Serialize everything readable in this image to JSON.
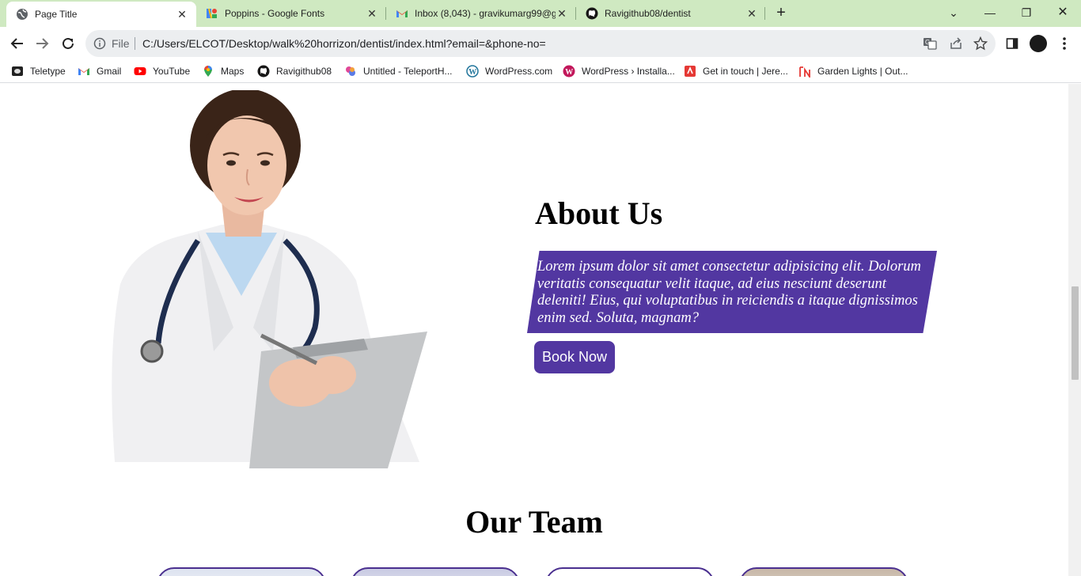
{
  "browser": {
    "tabs": [
      {
        "title": "Page Title",
        "active": true,
        "icon": "globe-icon"
      },
      {
        "title": "Poppins - Google Fonts",
        "active": false,
        "icon": "google-fonts-icon"
      },
      {
        "title": "Inbox (8,043) - gravikumarg99@g",
        "active": false,
        "icon": "gmail-icon"
      },
      {
        "title": "Ravigithub08/dentist",
        "active": false,
        "icon": "github-icon"
      }
    ],
    "close_glyph": "✕",
    "newtab_glyph": "+",
    "window": {
      "minimize": "—",
      "restore": "❐",
      "close": "✕",
      "dropdown": "⌄"
    },
    "omnibox": {
      "scheme_label": "File",
      "url": "C:/Users/ELCOT/Desktop/walk%20horrizon/dentist/index.html?email=&phone-no="
    },
    "bookmarks": [
      {
        "label": "Teletype",
        "icon": "teletype-icon",
        "color": "#222222"
      },
      {
        "label": "Gmail",
        "icon": "gmail-icon",
        "color": "#EA4335"
      },
      {
        "label": "YouTube",
        "icon": "youtube-icon",
        "color": "#FF0000"
      },
      {
        "label": "Maps",
        "icon": "maps-icon",
        "color": "#34A853"
      },
      {
        "label": "Ravigithub08",
        "icon": "github-icon",
        "color": "#181717"
      },
      {
        "label": "Untitled - TeleportH...",
        "icon": "teleporthq-icon",
        "color": "#E04898"
      },
      {
        "label": "WordPress.com",
        "icon": "wordpress-icon",
        "color": "#21759B"
      },
      {
        "label": "WordPress › Installa...",
        "icon": "wordpress-install-icon",
        "color": "#C2185B"
      },
      {
        "label": "Get in touch | Jere...",
        "icon": "jeremy-icon",
        "color": "#E53935"
      },
      {
        "label": "Garden Lights | Out...",
        "icon": "garden-lights-icon",
        "color": "#E53935"
      }
    ]
  },
  "page": {
    "about": {
      "title": "About Us",
      "text": "Lorem ipsum dolor sit amet consectetur adipisicing elit. Dolorum veritatis consequatur velit itaque, ad eius nesciunt deserunt deleniti! Eius, qui voluptatibus in reiciendis a itaque dignissimos enim sed. Soluta, magnam?",
      "button": "Book Now"
    },
    "team": {
      "title": "Our Team"
    },
    "colors": {
      "accent": "#5237A1",
      "text": "#000000",
      "background": "#FFFFFF"
    }
  }
}
